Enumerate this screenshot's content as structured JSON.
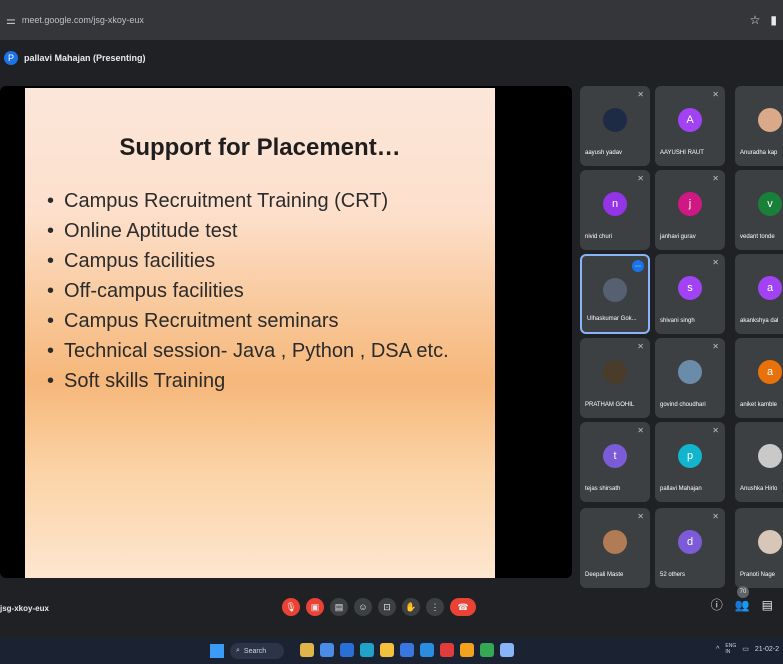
{
  "browser": {
    "url": "meet.google.com/jsg-xkoy-eux"
  },
  "presenter": {
    "initial": "P",
    "label": "pallavi Mahajan (Presenting)"
  },
  "slide": {
    "title": "Support for Placement…",
    "bullets": [
      "Campus Recruitment Training (CRT)",
      "Online Aptitude test",
      "Campus facilities",
      "Off-campus facilities",
      "Campus Recruitment seminars",
      "Technical session- Java , Python , DSA etc.",
      "Soft skills Training"
    ]
  },
  "participants": [
    {
      "name": "aayush yadav",
      "initial": "",
      "color": "#1e2b44"
    },
    {
      "name": "AAYUSHI RAUT",
      "initial": "A",
      "color": "#a142f4"
    },
    {
      "name": "Anuradha kap",
      "initial": "",
      "color": "#d9a98a"
    },
    {
      "name": "nivid churi",
      "initial": "n",
      "color": "#9334e6"
    },
    {
      "name": "janhavi gurav",
      "initial": "j",
      "color": "#d01884"
    },
    {
      "name": "vedant tonde",
      "initial": "v",
      "color": "#188038"
    },
    {
      "name": "Ulhaskumar Gok...",
      "initial": "",
      "color": "#566070"
    },
    {
      "name": "shivani singh",
      "initial": "s",
      "color": "#a142f4"
    },
    {
      "name": "akankshya dal",
      "initial": "a",
      "color": "#a142f4"
    },
    {
      "name": "PRATHAM GOHIL",
      "initial": "",
      "color": "#4a3b2a"
    },
    {
      "name": "govind choudhari",
      "initial": "",
      "color": "#6b8ca8"
    },
    {
      "name": "aniket kamble",
      "initial": "a",
      "color": "#e8710a"
    },
    {
      "name": "tejas shirsath",
      "initial": "t",
      "color": "#7b5cd6"
    },
    {
      "name": "pallavi Mahajan",
      "initial": "p",
      "color": "#12b5cb"
    },
    {
      "name": "Anushka Hirlo",
      "initial": "",
      "color": "#c9c9c9"
    },
    {
      "name": "Deepali Maste",
      "initial": "",
      "color": "#b07b55"
    },
    {
      "name": "52 others",
      "initial": "d",
      "color": "#7b5cd6"
    },
    {
      "name": "Pranoti Nage",
      "initial": "",
      "color": "#d8c7b8"
    }
  ],
  "callbar": {
    "meeting_code": "jsg-xkoy-eux",
    "participant_count": "70"
  },
  "taskbar": {
    "search": "Search",
    "lang": "ENG\nIN",
    "time": "21-02-2"
  }
}
